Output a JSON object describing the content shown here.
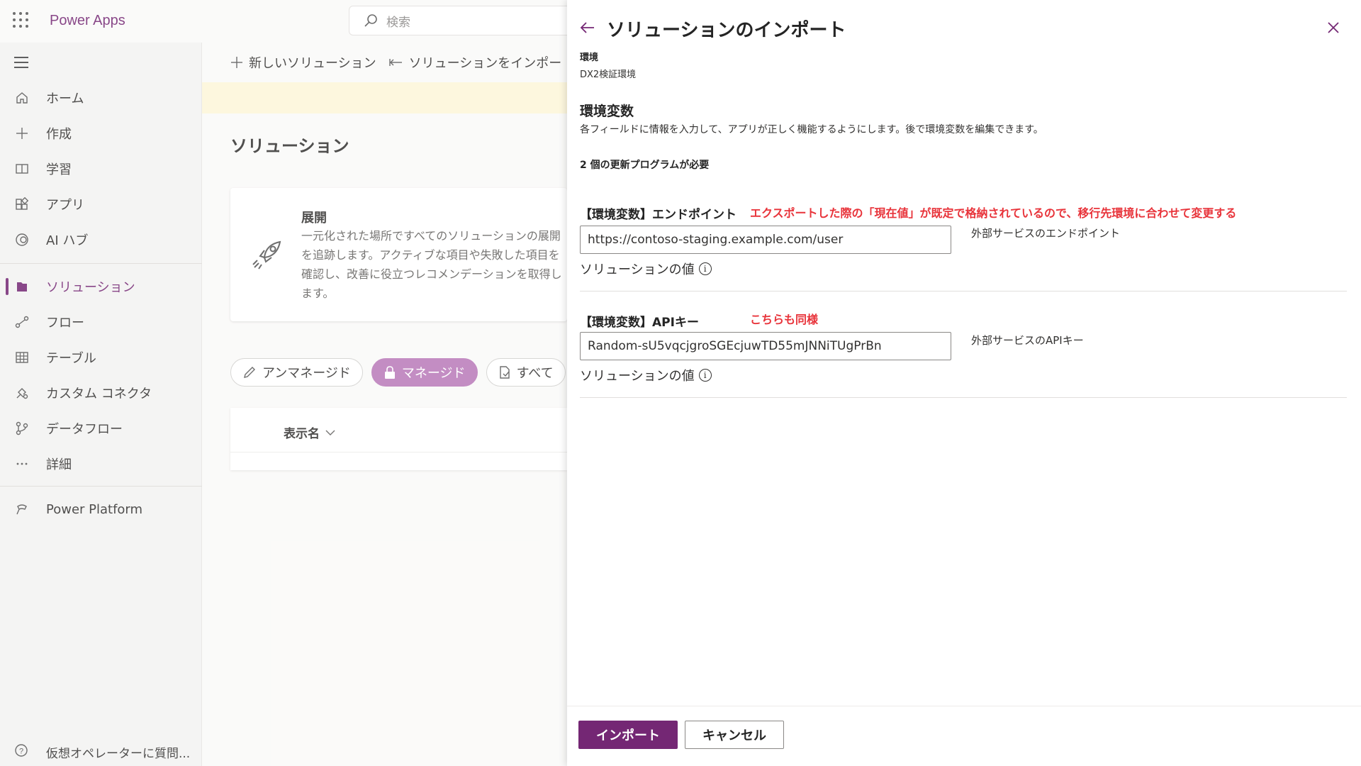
{
  "app": {
    "brand": "Power Apps"
  },
  "search": {
    "placeholder": "検索"
  },
  "sidebar": {
    "items": [
      {
        "label": "ホーム"
      },
      {
        "label": "作成"
      },
      {
        "label": "学習"
      },
      {
        "label": "アプリ"
      },
      {
        "label": "AI ハブ"
      },
      {
        "label": "ソリューション"
      },
      {
        "label": "フロー"
      },
      {
        "label": "テーブル"
      },
      {
        "label": "カスタム コネクタ"
      },
      {
        "label": "データフロー"
      },
      {
        "label": "詳細"
      },
      {
        "label": "Power Platform"
      }
    ],
    "assistant": "仮想オペレーターに質問..."
  },
  "main": {
    "cmd_new": "新しいソリューション",
    "cmd_import": "ソリューションをインポー",
    "title": "ソリューション",
    "card_title": "展開",
    "card_text": "一元化された場所ですべてのソリューションの展開を追跡します。アクティブな項目や失敗した項目を確認し、改善に役立つレコメンデーションを取得します。",
    "filters": [
      "アンマネージド",
      "マネージド",
      "すべて"
    ],
    "col_display_name": "表示名"
  },
  "panel": {
    "title": "ソリューションのインポート",
    "env_label": "環境",
    "env_value": "DX2検証環境",
    "section_title": "環境変数",
    "section_desc": "各フィールドに情報を入力して、アプリが正しく機能するようにします。後で環境変数を編集できます。",
    "updates_needed": "2 個の更新プログラムが必要",
    "variables": [
      {
        "label": "【環境変数】エンドポイント",
        "note": "エクスポートした際の「現在値」が既定で格納されているので、移行先環境に合わせて変更する",
        "value": "https://contoso-staging.example.com/user",
        "description": "外部サービスのエンドポイント",
        "solution_value": "ソリューションの値"
      },
      {
        "label": "【環境変数】APIキー",
        "note": "こちらも同様",
        "value": "Random-sU5vqcjgroSGEcjuwTD55mJNNiTUgPrBn",
        "description": "外部サービスのAPIキー",
        "solution_value": "ソリューションの値"
      }
    ],
    "import_button": "インポート",
    "cancel_button": "キャンセル"
  },
  "colors": {
    "accent": "#742774",
    "note": "#e8333a"
  }
}
